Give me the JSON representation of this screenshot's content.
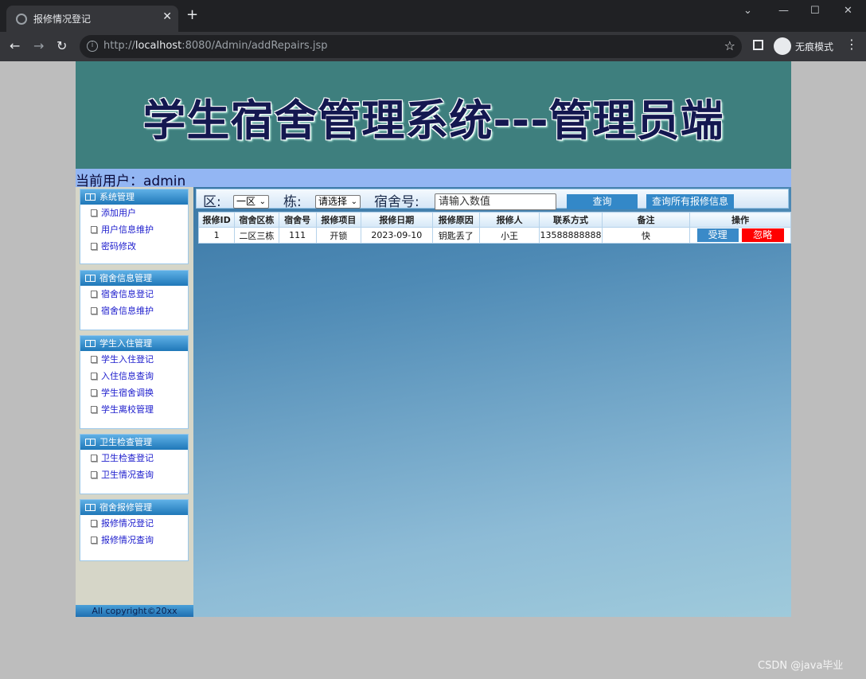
{
  "browser": {
    "tab_title": "报修情况登记",
    "url_prefix": "http://",
    "url_host": "localhost",
    "url_path": ":8080/Admin/addRepairs.jsp",
    "incognito_label": "无痕模式",
    "window_min": "—",
    "window_max": "☐",
    "window_close": "✕",
    "tab_dropdown": "⌄",
    "newtab": "+"
  },
  "header": {
    "title": "学生宿舍管理系统---管理员端",
    "current_user": "当前用户：admin"
  },
  "sidebar": {
    "groups": [
      {
        "title": "系统管理",
        "items": [
          "添加用户",
          "用户信息维护",
          "密码修改"
        ]
      },
      {
        "title": "宿舍信息管理",
        "items": [
          "宿舍信息登记",
          "宿舍信息维护"
        ]
      },
      {
        "title": "学生入住管理",
        "items": [
          "学生入住登记",
          "入住信息查询",
          "学生宿舍调换",
          "学生离校管理"
        ]
      },
      {
        "title": "卫生检查管理",
        "items": [
          "卫生检查登记",
          "卫生情况查询"
        ]
      },
      {
        "title": "宿舍报修管理",
        "items": [
          "报修情况登记",
          "报修情况查询"
        ]
      }
    ],
    "copyright": "All copyright©20xx"
  },
  "search": {
    "area_label": "区:",
    "area_value": "一区",
    "building_label": "栋:",
    "building_value": "请选择",
    "room_label": "宿舍号:",
    "room_placeholder": "请输入数值",
    "query_button": "查询",
    "query_all_button": "查询所有报修信息"
  },
  "table": {
    "headers": [
      "报修ID",
      "宿舍区栋",
      "宿舍号",
      "报修项目",
      "报修日期",
      "报修原因",
      "报修人",
      "联系方式",
      "备注",
      "操作"
    ],
    "rows": [
      {
        "id": "1",
        "area": "二区三栋",
        "room": "111",
        "item": "开锁",
        "date": "2023-09-10",
        "reason": "钥匙丢了",
        "reporter": "小王",
        "phone": "13588888888",
        "note": "快",
        "accept": "受理",
        "ignore": "忽略"
      }
    ]
  },
  "watermark": "CSDN @java毕业",
  "colors": {
    "banner": "#3e7f7e",
    "userbar": "#93b6f3",
    "menu_header": "#1f77b8",
    "accept_button": "#3a8ac8",
    "ignore_button": "#ff0000"
  }
}
